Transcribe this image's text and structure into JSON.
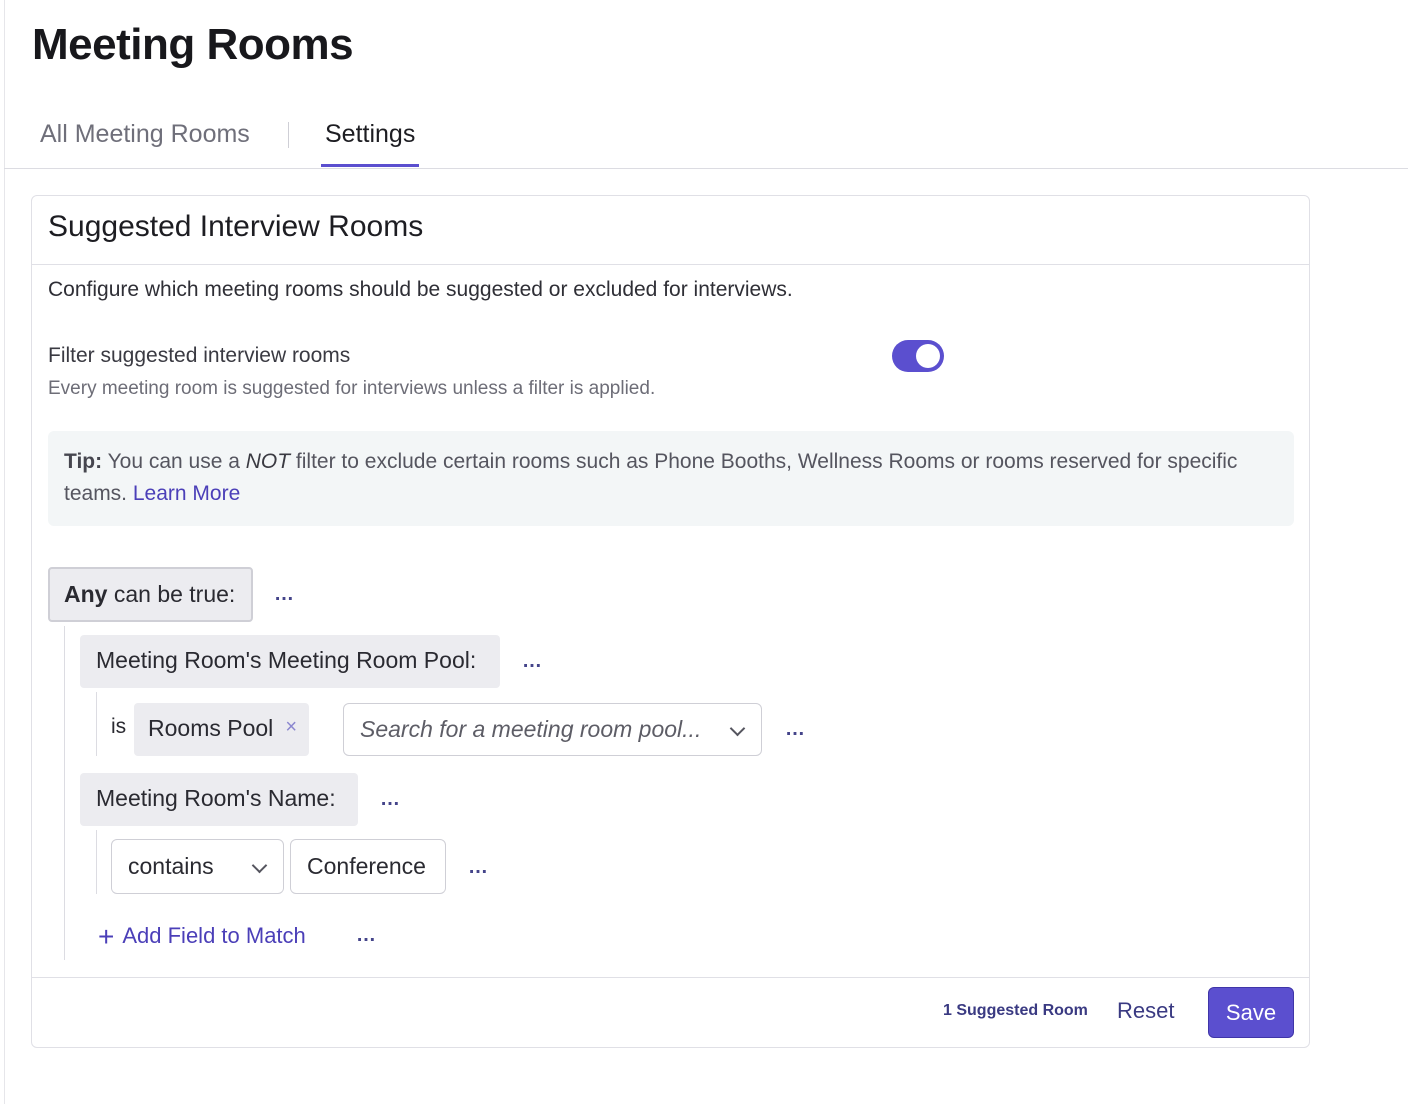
{
  "page": {
    "title": "Meeting Rooms"
  },
  "tabs": [
    {
      "label": "All Meeting Rooms",
      "active": false
    },
    {
      "label": "Settings",
      "active": true
    }
  ],
  "card": {
    "title": "Suggested Interview Rooms",
    "description": "Configure which meeting rooms should be suggested or excluded for interviews.",
    "filter_toggle": {
      "label": "Filter suggested interview rooms",
      "sublabel": "Every meeting room is suggested for interviews unless a filter is applied.",
      "enabled": true
    },
    "tip": {
      "prefix": "Tip:",
      "text_before": " You can use a ",
      "not_word": "NOT",
      "text_after": " filter to exclude certain rooms such as Phone Booths, Wellness Rooms or rooms reserved for specific teams. ",
      "link": "Learn More"
    }
  },
  "filter": {
    "group_bold": "Any",
    "group_rest": " can be true:",
    "more_icon": "…",
    "conditions": [
      {
        "field": "Meeting Room's Meeting Room Pool:",
        "operator": "is",
        "chip": "Rooms Pool",
        "chip_remove": "×",
        "search_placeholder": "Search for a meeting room pool..."
      },
      {
        "field": "Meeting Room's Name:",
        "operator": "contains",
        "value": "Conference"
      }
    ],
    "add_label": "Add Field to Match",
    "add_icon": "+"
  },
  "footer": {
    "suggested_count": "1 Suggested Room",
    "reset_label": "Reset",
    "save_label": "Save"
  },
  "colors": {
    "accent": "#5b4fcf",
    "link": "#4b3fb8"
  }
}
